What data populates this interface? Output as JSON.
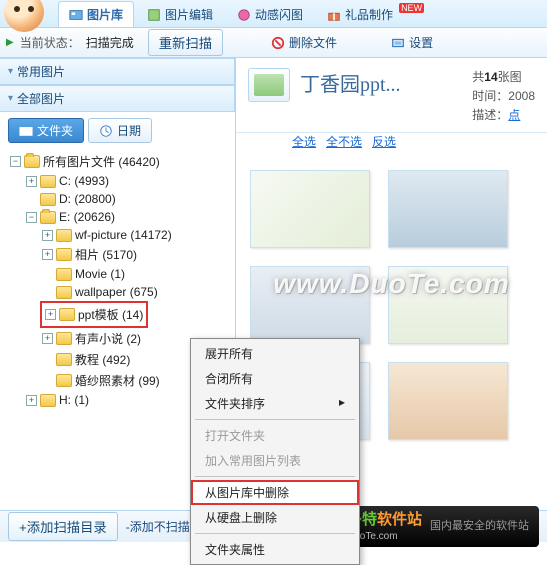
{
  "tabs": {
    "library": "图片库",
    "edit": "图片编辑",
    "flash": "动感闪图",
    "gift": "礼品制作",
    "new_badge": "NEW"
  },
  "toolbar": {
    "status_label": "当前状态：",
    "status_value": "扫描完成",
    "rescan": "重新扫描",
    "delete": "删除文件",
    "settings": "设置"
  },
  "left": {
    "common_pics": "常用图片",
    "all_pics": "全部图片",
    "subtabs": {
      "folder": "文件夹",
      "date": "日期"
    }
  },
  "tree": {
    "root": "所有图片文件  (46420)",
    "c": "C:  (4993)",
    "d": "D:  (20800)",
    "e": "E:  (20626)",
    "wf": "wf-picture  (14172)",
    "xiangpian": "相片  (5170)",
    "movie": "Movie  (1)",
    "wallpaper": "wallpaper  (675)",
    "ppt": "ppt模板  (14)",
    "novel": "有声小说  (2)",
    "jiaocheng": "教程  (492)",
    "hunsha": "婚纱照素材  (99)",
    "h": "H:  (1)"
  },
  "right": {
    "title": "丁香园ppt...",
    "count_prefix": "共",
    "count_num": "14",
    "count_suffix": "张图",
    "time_label": "时间：",
    "time_value": "2008",
    "desc_label": "描述：",
    "desc_value": "点",
    "sel_all": "全选",
    "sel_none": "全不选",
    "sel_inv": "反选"
  },
  "ctx": {
    "expand_all": "展开所有",
    "collapse_all": "合闭所有",
    "sort": "文件夹排序",
    "open": "打开文件夹",
    "add_common": "加入常用图片列表",
    "remove_lib": "从图片库中删除",
    "remove_disk": "从硬盘上删除",
    "props": "文件夹属性"
  },
  "bottom": {
    "add_scan": "+添加扫描目录",
    "sub_scan": "-添加不扫描目录"
  },
  "watermark": "www.DuoTe.com",
  "duote": {
    "brand_cn": "多特",
    "brand_suffix": "软件站",
    "brand_en": "DuoTe.com",
    "tag": "国内最安全的软件站"
  }
}
